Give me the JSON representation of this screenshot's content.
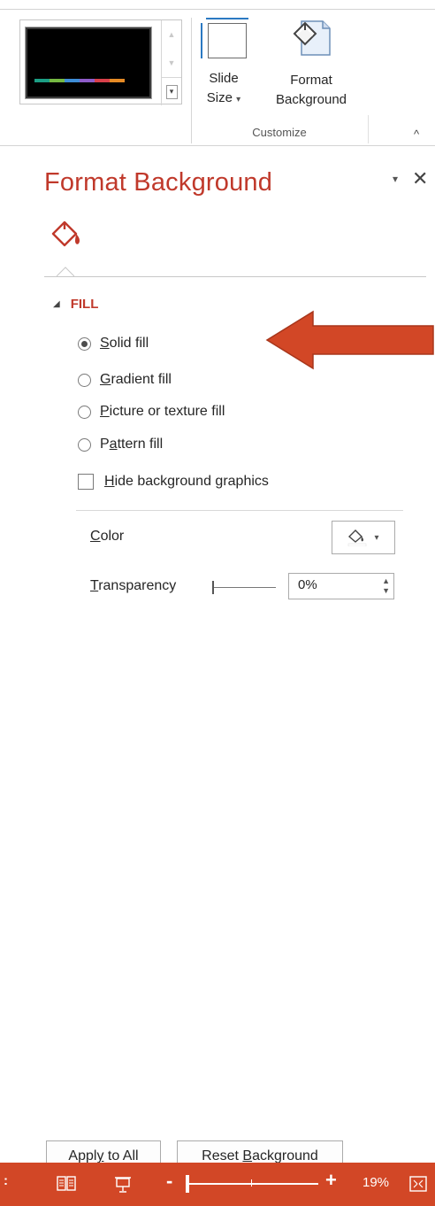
{
  "ribbon": {
    "theme_swatch_colors": [
      "#1c9e84",
      "#75b843",
      "#3e8dd6",
      "#8e5cc8",
      "#d8404a",
      "#e58a25"
    ],
    "slide_size": {
      "line1": "Slide",
      "line2": "Size",
      "dropdown": "▾",
      "icon": "slide-size-icon"
    },
    "format_background": {
      "line1": "Format",
      "line2": "Background",
      "icon": "format-background-icon"
    },
    "group_label": "Customize",
    "collapse": "^"
  },
  "pane": {
    "title": "Format Background",
    "dropdown_glyph": "▾",
    "close_glyph": "✕",
    "tab_icon": "paint-bucket-icon",
    "section": {
      "triangle": "◢",
      "title": "FILL"
    },
    "fill_options": [
      {
        "accel": "S",
        "rest": "olid fill",
        "selected": true
      },
      {
        "accel": "G",
        "rest": "radient fill",
        "selected": false
      },
      {
        "accel": "P",
        "rest": "icture or texture fill",
        "selected": false
      },
      {
        "pre": "P",
        "accel": "a",
        "rest": "ttern fill",
        "selected": false
      }
    ],
    "hide_graphics": {
      "accel": "H",
      "rest": "ide background graphics",
      "checked": false
    },
    "color": {
      "accel": "C",
      "rest": "olor",
      "dropdown": "▾"
    },
    "transparency": {
      "accel": "T",
      "rest": "ransparency",
      "value": "0%",
      "slider_fraction": 0
    },
    "apply_all": {
      "pre": "Apply to All",
      "accel": "",
      "rest": ""
    },
    "reset": {
      "pre": "Reset ",
      "accel": "B",
      "rest": "ackground"
    }
  },
  "annotation": {
    "color": "#d24726",
    "direction": "left"
  },
  "status_bar": {
    "color": "#d24726",
    "left_glyph": ":",
    "zoom_minus": "-",
    "zoom_plus": "+",
    "zoom": "19%"
  }
}
